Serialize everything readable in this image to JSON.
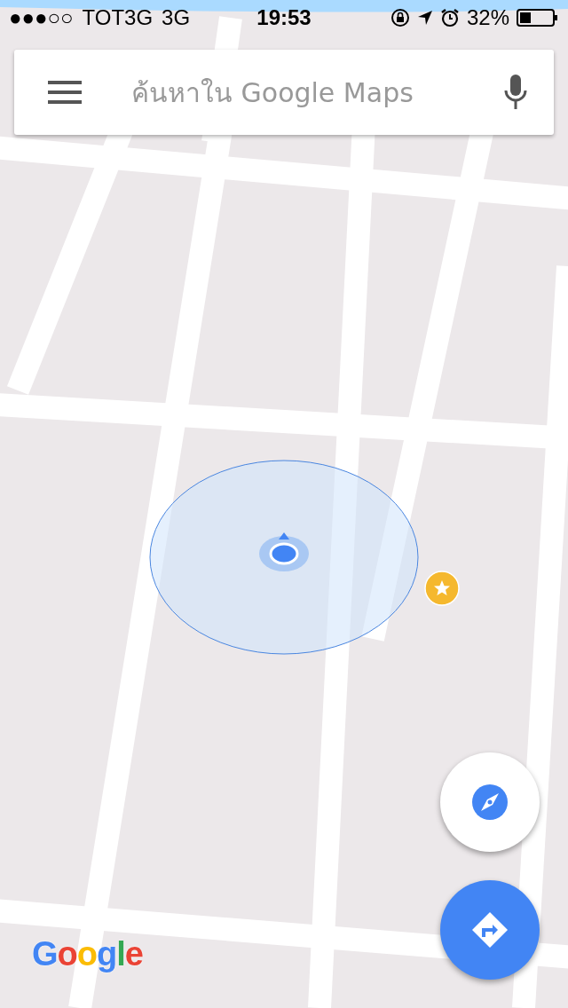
{
  "status_bar": {
    "signal": "●●●○○",
    "carrier": "TOT3G",
    "network": "3G",
    "time": "19:53",
    "battery": "32%"
  },
  "search": {
    "placeholder": "ค้นหาใน Google Maps"
  },
  "logo": "Google"
}
